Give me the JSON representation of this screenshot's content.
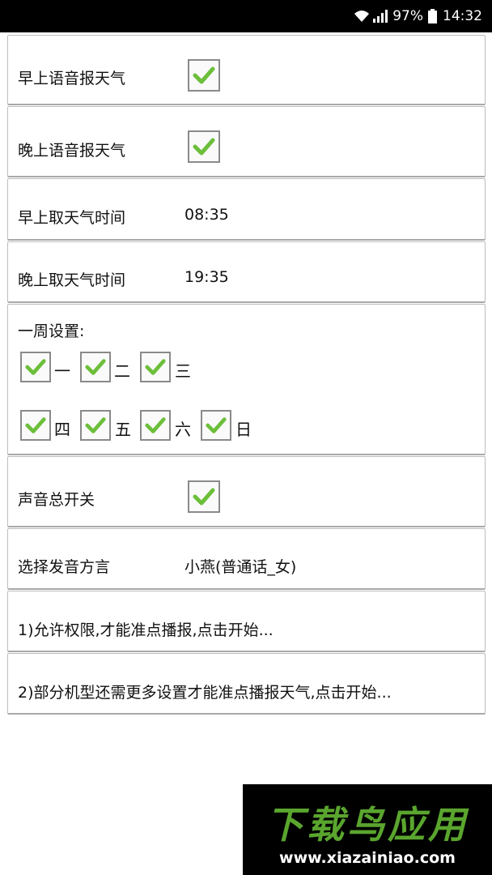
{
  "status_bar": {
    "battery": "97%",
    "time": "14:32"
  },
  "settings": {
    "morning_voice": {
      "label": "早上语音报天气",
      "checked": true
    },
    "evening_voice": {
      "label": "晚上语音报天气",
      "checked": true
    },
    "morning_time": {
      "label": "早上取天气时间",
      "value": "08:35"
    },
    "evening_time": {
      "label": "晚上取天气时间",
      "value": "19:35"
    },
    "week": {
      "label": "一周设置:",
      "days": [
        {
          "label": "一",
          "checked": true
        },
        {
          "label": "二",
          "checked": true
        },
        {
          "label": "三",
          "checked": true
        },
        {
          "label": "四",
          "checked": true
        },
        {
          "label": "五",
          "checked": true
        },
        {
          "label": "六",
          "checked": true
        },
        {
          "label": "日",
          "checked": true
        }
      ]
    },
    "sound_master": {
      "label": "声音总开关",
      "checked": true
    },
    "dialect": {
      "label": "选择发音方言",
      "value": "小燕(普通话_女)"
    },
    "permission_hint": "1)允许权限,才能准点播报,点击开始...",
    "model_hint": "2)部分机型还需更多设置才能准点播报天气,点击开始..."
  },
  "watermark": {
    "title": "下载鸟应用",
    "url": "www.xiazainiao.com"
  },
  "colors": {
    "check": "#6cbf3a",
    "statusbar": "#000000",
    "watermark_green": "#5aa52e"
  }
}
